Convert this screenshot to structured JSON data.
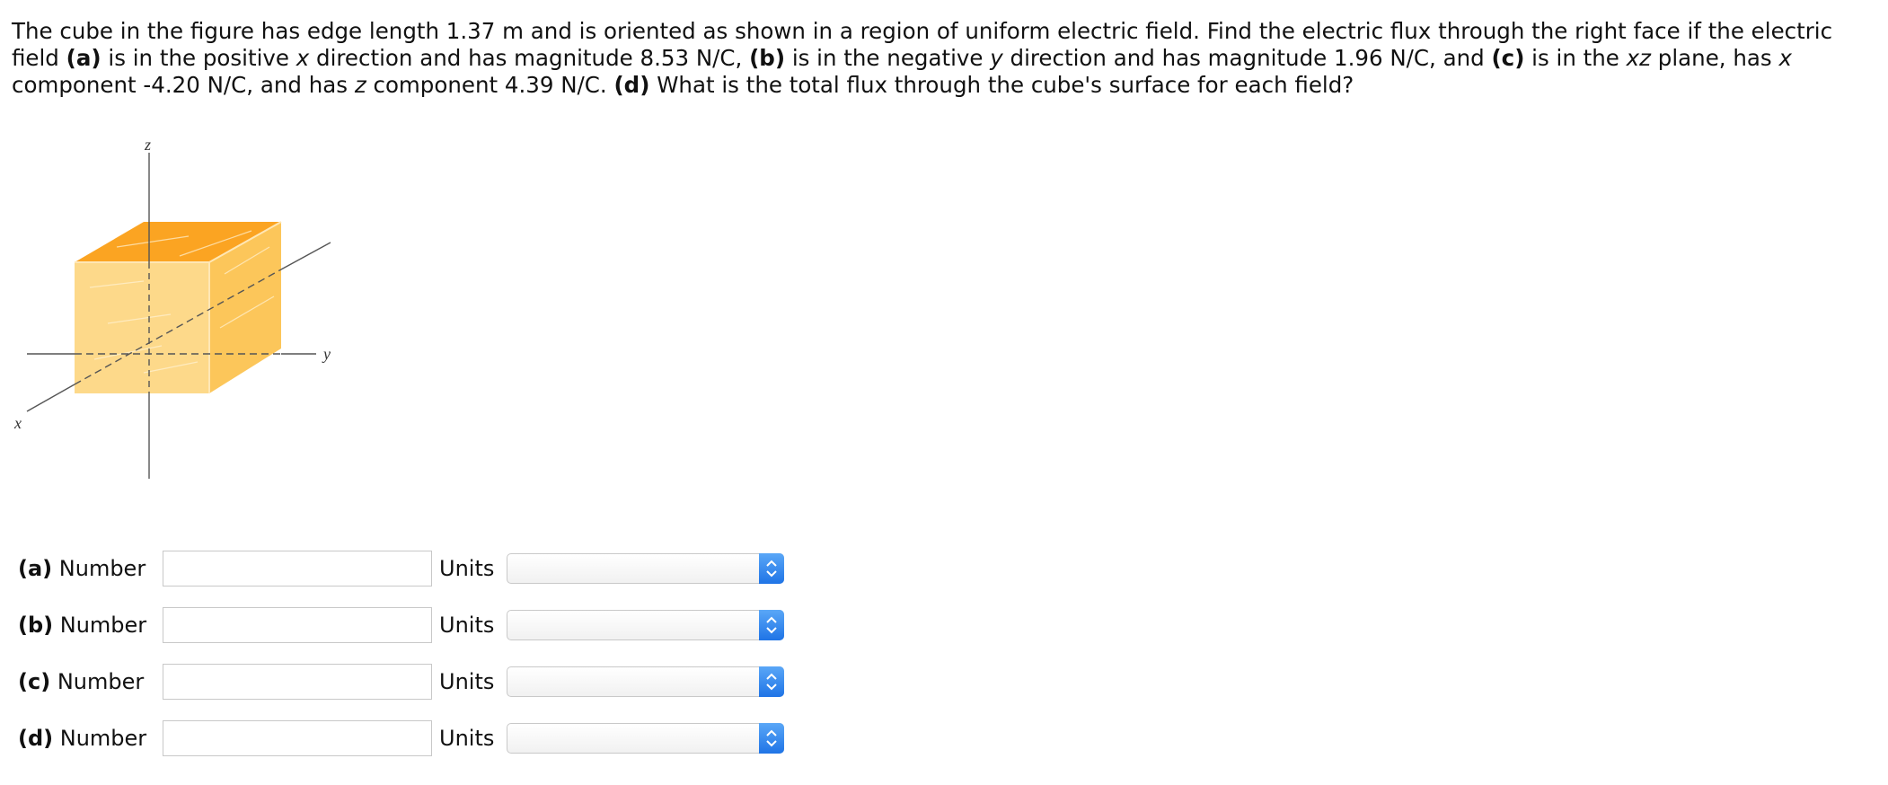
{
  "problem": {
    "intro": "The cube in the figure has edge length 1.37 m and is oriented as shown in a region of uniform electric field. Find the electric flux through the right face if the electric field ",
    "a_tag": "(a)",
    "a_text_1": " is in the positive ",
    "a_var": "x",
    "a_text_2": " direction and has magnitude 8.53 N/C, ",
    "b_tag": "(b)",
    "b_text_1": " is in the negative ",
    "b_var": "y",
    "b_text_2": " direction and has magnitude 1.96 N/C, and ",
    "c_tag": "(c)",
    "c_text_1": " is in the ",
    "c_var_plane": "xz",
    "c_text_2": " plane, has ",
    "c_var_x": "x",
    "c_text_3": " component -4.20 N/C, and has ",
    "c_var_z": "z",
    "c_text_4": " component 4.39 N/C. ",
    "d_tag": "(d)",
    "d_text": " What is the total flux through the cube's surface for each field?"
  },
  "figure": {
    "axis_z": "z",
    "axis_y": "y",
    "axis_x": "x",
    "colors": {
      "front": "#fdd98a",
      "top": "#fba422",
      "right": "#fcc65a",
      "axis": "#555555"
    }
  },
  "answers": [
    {
      "part": "(a)",
      "number_label": "Number",
      "number_value": "",
      "units_label": "Units",
      "units_selected": ""
    },
    {
      "part": "(b)",
      "number_label": "Number",
      "number_value": "",
      "units_label": "Units",
      "units_selected": ""
    },
    {
      "part": "(c)",
      "number_label": "Number",
      "number_value": "",
      "units_label": "Units",
      "units_selected": ""
    },
    {
      "part": "(d)",
      "number_label": "Number",
      "number_value": "",
      "units_label": "Units",
      "units_selected": ""
    }
  ]
}
